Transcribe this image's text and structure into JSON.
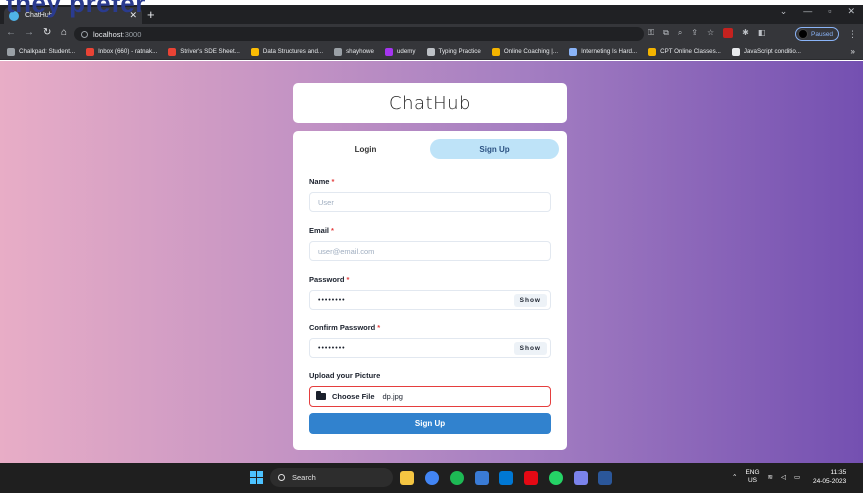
{
  "overlay_text": "they prefer",
  "browser": {
    "tab_title": "ChatHub",
    "url_host": "localhost",
    "url_port": ":3000",
    "profile_status": "Paused",
    "bookmarks": [
      {
        "label": "Chalkpad: Student...",
        "color": "#9aa0a6"
      },
      {
        "label": "Inbox (660) - ratnak...",
        "color": "#ea4335"
      },
      {
        "label": "Striver's SDE Sheet...",
        "color": "#ea4335"
      },
      {
        "label": "Data Structures and...",
        "color": "#fbbc04"
      },
      {
        "label": "shayhowe",
        "color": "#9aa0a6"
      },
      {
        "label": "udemy",
        "color": "#a435f0"
      },
      {
        "label": "Typing Practice",
        "color": "#bdc1c6"
      },
      {
        "label": "Online Coaching |...",
        "color": "#f4b400"
      },
      {
        "label": "Interneting Is Hard...",
        "color": "#8ab4f8"
      },
      {
        "label": "CPT Online Classes...",
        "color": "#f4b400"
      },
      {
        "label": "JavaScript conditio...",
        "color": "#e8eaed"
      }
    ]
  },
  "app": {
    "title": "ChatHub",
    "tabs": {
      "login": "Login",
      "signup": "Sign Up"
    },
    "fields": {
      "name": {
        "label": "Name",
        "placeholder": "User"
      },
      "email": {
        "label": "Email",
        "placeholder": "user@email.com"
      },
      "password": {
        "label": "Password",
        "value": "••••••••",
        "toggle": "Show"
      },
      "confirm": {
        "label": "Confirm Password",
        "value": "••••••••",
        "toggle": "Show"
      },
      "picture": {
        "label": "Upload your Picture",
        "button": "Choose File",
        "filename": "dp.jpg"
      }
    },
    "required_mark": "*",
    "submit": "Sign Up"
  },
  "taskbar": {
    "search": "Search",
    "lang_1": "ENG",
    "lang_2": "US",
    "time": "11:35",
    "date": "24-05-2023"
  },
  "colors": {
    "accent": "#3182ce",
    "active_tab": "#bee3f8",
    "required": "#e53e3e"
  }
}
